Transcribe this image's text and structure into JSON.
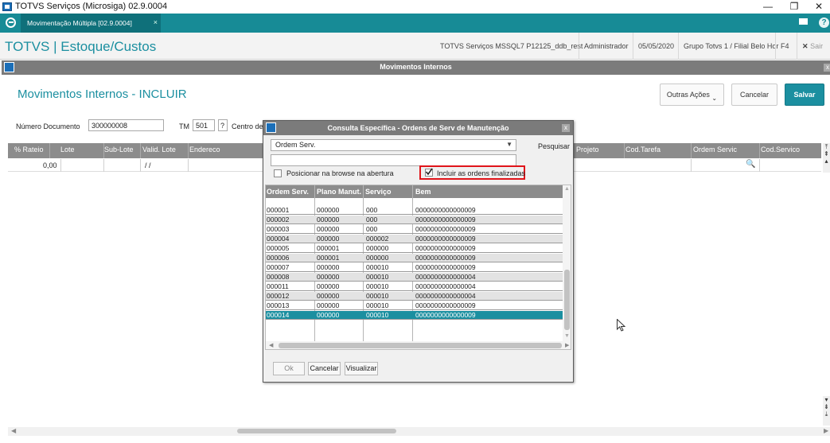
{
  "window": {
    "title": "TOTVS Serviços (Microsiga) 02.9.0004",
    "minimize": "—",
    "restore": "❐",
    "close": "✕"
  },
  "tabs": [
    {
      "label": "Movimentação Múltipla [02.9.0004]",
      "close": "×"
    }
  ],
  "header": {
    "brand": "TOTVS | Estoque/Custos",
    "environment": "TOTVS Serviços MSSQL7 P12125_ddb_rest",
    "user": "Administrador",
    "date": "05/05/2020",
    "branch": "Grupo Totvs 1 / Filial Belo Hor",
    "shortcut": "F4",
    "exit_label": "Sair",
    "exit_icon": "✕"
  },
  "inner_window": {
    "title": "Movimentos Internos"
  },
  "page": {
    "title": "Movimentos Internos - INCLUIR",
    "actions": {
      "more": "Outras Ações",
      "cancel": "Cancelar",
      "save": "Salvar"
    }
  },
  "form": {
    "doc_label": "Número Documento",
    "doc_value": "300000008",
    "tm_label": "TM",
    "tm_value": "501",
    "tm_help": "?",
    "cost_center_label": "Centro de"
  },
  "grid": {
    "columns_left": [
      "% Rateio",
      "Lote",
      "Sub-Lote",
      "Valid. Lote",
      "Endereco"
    ],
    "columns_right": [
      "Projeto",
      "Cod.Tarefa",
      "Ordem Servic",
      "Cod.Servico"
    ],
    "row": {
      "rateio": "0,00",
      "valid_lote": "/ /"
    }
  },
  "dialog": {
    "title": "Consulta Específica - Ordens de Serv de Manutenção",
    "close": "x",
    "index_select": "Ordem Serv.",
    "search_button": "Pesquisar",
    "search_value": "",
    "position_checkbox": {
      "label": "Posicionar na browse na abertura",
      "checked": false
    },
    "include_finished_checkbox": {
      "label": "Incluir as ordens finalizadas",
      "checked": true
    },
    "table": {
      "columns": [
        "Ordem Serv.",
        "Plano Manut.",
        "Serviço",
        "Bem"
      ],
      "rows": [
        [
          "000001",
          "000000",
          "000",
          "0000000000000009"
        ],
        [
          "000002",
          "000000",
          "000",
          "0000000000000009"
        ],
        [
          "000003",
          "000000",
          "000",
          "0000000000000009"
        ],
        [
          "000004",
          "000000",
          "000002",
          "0000000000000009"
        ],
        [
          "000005",
          "000001",
          "000000",
          "0000000000000009"
        ],
        [
          "000006",
          "000001",
          "000000",
          "0000000000000009"
        ],
        [
          "000007",
          "000000",
          "000010",
          "0000000000000009"
        ],
        [
          "000008",
          "000000",
          "000010",
          "0000000000000004"
        ],
        [
          "000011",
          "000000",
          "000010",
          "0000000000000004"
        ],
        [
          "000012",
          "000000",
          "000010",
          "0000000000000004"
        ],
        [
          "000013",
          "000000",
          "000010",
          "0000000000000009"
        ],
        [
          "000014",
          "000000",
          "000010",
          "0000000000000009"
        ]
      ],
      "selected_row": 11
    },
    "buttons": {
      "ok": "Ok",
      "cancel": "Cancelar",
      "view": "Visualizar"
    }
  },
  "colors": {
    "accent": "#1b8fa0",
    "tabbar": "#178b96",
    "highlight_box": "#e0141a"
  }
}
